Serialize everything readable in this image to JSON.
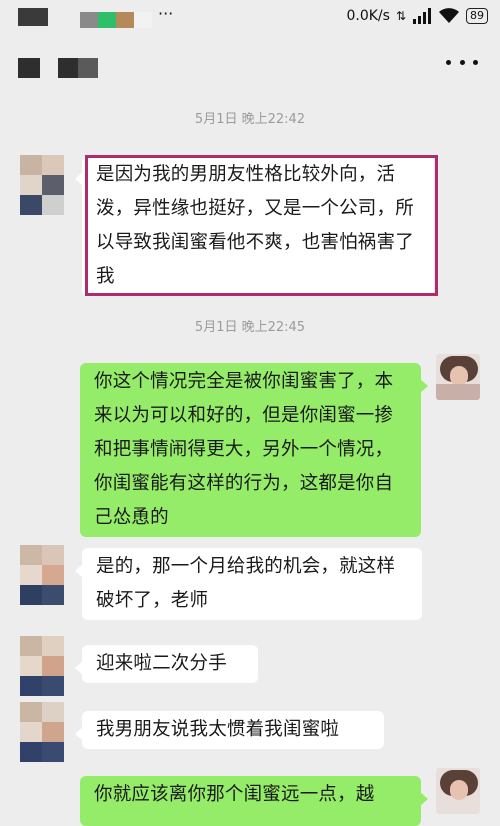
{
  "status_bar": {
    "network_speed": "0.0K/s",
    "battery": "89",
    "signal_icon": "signal-bars-icon",
    "wifi_icon": "wifi-icon"
  },
  "header": {
    "more_icon": "more-dots-icon"
  },
  "colors": {
    "background": "#ededed",
    "bubble_self": "#95ec69",
    "bubble_other": "#ffffff",
    "highlight": "#b02a6e",
    "timestamp": "#9b9b9b"
  },
  "messages": [
    {
      "timestamp": "5月1日 晚上22:42"
    },
    {
      "from": "other",
      "highlighted": true,
      "text": "是因为我的男朋友性格比较外向，活泼，异性缘也挺好，又是一个公司，所以导致我闺蜜看他不爽，也害怕祸害了我"
    },
    {
      "timestamp": "5月1日 晚上22:45"
    },
    {
      "from": "self",
      "text": "你这个情况完全是被你闺蜜害了，本来以为可以和好的，但是你闺蜜一掺和把事情闹得更大，另外一个情况，你闺蜜能有这样的行为，这都是你自己怂恿的"
    },
    {
      "from": "other",
      "text": "是的，那一个月给我的机会，就这样破坏了，老师"
    },
    {
      "from": "other",
      "text": "迎来啦二次分手"
    },
    {
      "from": "other",
      "text": "我男朋友说我太惯着我闺蜜啦"
    },
    {
      "from": "self",
      "text": "你就应该离你那个闺蜜远一点，越"
    }
  ]
}
